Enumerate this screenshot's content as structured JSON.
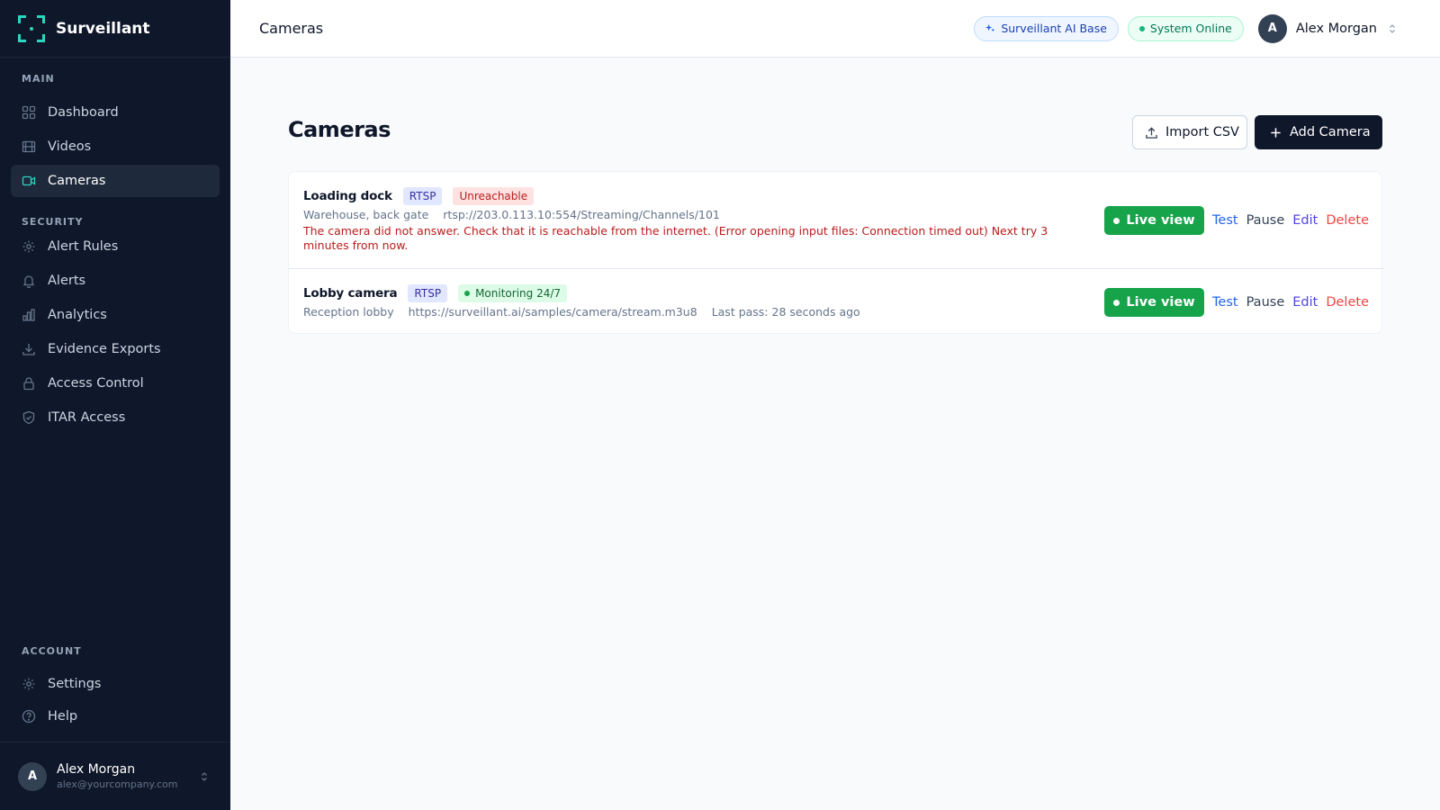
{
  "app": {
    "name": "Surveillant"
  },
  "sidebar": {
    "sections": [
      {
        "label": "MAIN",
        "items": [
          {
            "label": "Dashboard",
            "icon": "grid-icon"
          },
          {
            "label": "Videos",
            "icon": "film-icon"
          },
          {
            "label": "Cameras",
            "icon": "video-camera-icon",
            "active": true
          }
        ]
      },
      {
        "label": "SECURITY",
        "items": [
          {
            "label": "Alert Rules",
            "icon": "gear-icon"
          },
          {
            "label": "Alerts",
            "icon": "bell-icon"
          },
          {
            "label": "Analytics",
            "icon": "bar-chart-icon"
          },
          {
            "label": "Evidence Exports",
            "icon": "download-icon"
          },
          {
            "label": "Access Control",
            "icon": "lock-icon"
          },
          {
            "label": "ITAR Access",
            "icon": "shield-icon"
          }
        ]
      },
      {
        "label": "ACCOUNT",
        "items": [
          {
            "label": "Settings",
            "icon": "gear-icon"
          },
          {
            "label": "Help",
            "icon": "help-circle-icon"
          }
        ]
      }
    ]
  },
  "user": {
    "initial": "A",
    "name": "Alex Morgan",
    "email": "alex@yourcompany.com"
  },
  "header": {
    "title": "Cameras",
    "ai_badge": "Surveillant AI Base",
    "status_badge": "System Online"
  },
  "main": {
    "title": "Cameras",
    "import_label": "Import CSV",
    "add_label": "Add Camera",
    "cameras": [
      {
        "name": "Loading dock",
        "protocol": "RTSP",
        "status": "Unreachable",
        "location": "Warehouse, back gate",
        "url": "rtsp://203.0.113.10:554/Streaming/Channels/101",
        "error": "The camera did not answer. Check that it is reachable from the internet. (Error opening input files: Connection timed out) Next try 3 minutes from now."
      },
      {
        "name": "Lobby camera",
        "protocol": "RTSP",
        "status": "Monitoring 24/7",
        "location": "Reception lobby",
        "url": "https://surveillant.ai/samples/camera/stream.m3u8",
        "last_pass": "Last pass: 28 seconds ago"
      }
    ],
    "actions": {
      "live": "Live view",
      "test": "Test",
      "pause": "Pause",
      "edit": "Edit",
      "delete": "Delete"
    }
  },
  "colors": {
    "sidebar_bg": "#0f172a",
    "accent": "#2dd4bf",
    "live_green": "#16a34a",
    "danger": "#ef4444"
  }
}
